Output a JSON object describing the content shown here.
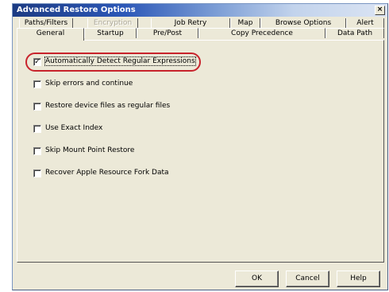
{
  "window": {
    "title": "Advanced Restore Options",
    "close_glyph": "×"
  },
  "tabs": {
    "row1": [
      "Paths/Filters",
      "Encryption",
      "Job Retry",
      "Map",
      "Browse Options",
      "Alert"
    ],
    "row2": [
      "General",
      "Startup",
      "Pre/Post",
      "Copy Precedence",
      "Data Path"
    ],
    "active": "General",
    "disabled": [
      "Encryption"
    ]
  },
  "options": [
    {
      "label": "Automatically Detect Regular Expressions",
      "checked": true,
      "check_glyph": "✓"
    },
    {
      "label": "Skip errors and continue",
      "checked": false
    },
    {
      "label": "Restore device files as regular files",
      "checked": false
    },
    {
      "label": "Use Exact Index",
      "checked": false
    },
    {
      "label": "Skip Mount Point Restore",
      "checked": false
    },
    {
      "label": "Recover Apple Resource Fork Data",
      "checked": false
    }
  ],
  "buttons": {
    "ok": "OK",
    "cancel": "Cancel",
    "help": "Help"
  },
  "colors": {
    "title_bar_start": "#1c3b83",
    "dialog_background": "#ece9d8",
    "highlight_ring": "#c8232c"
  }
}
